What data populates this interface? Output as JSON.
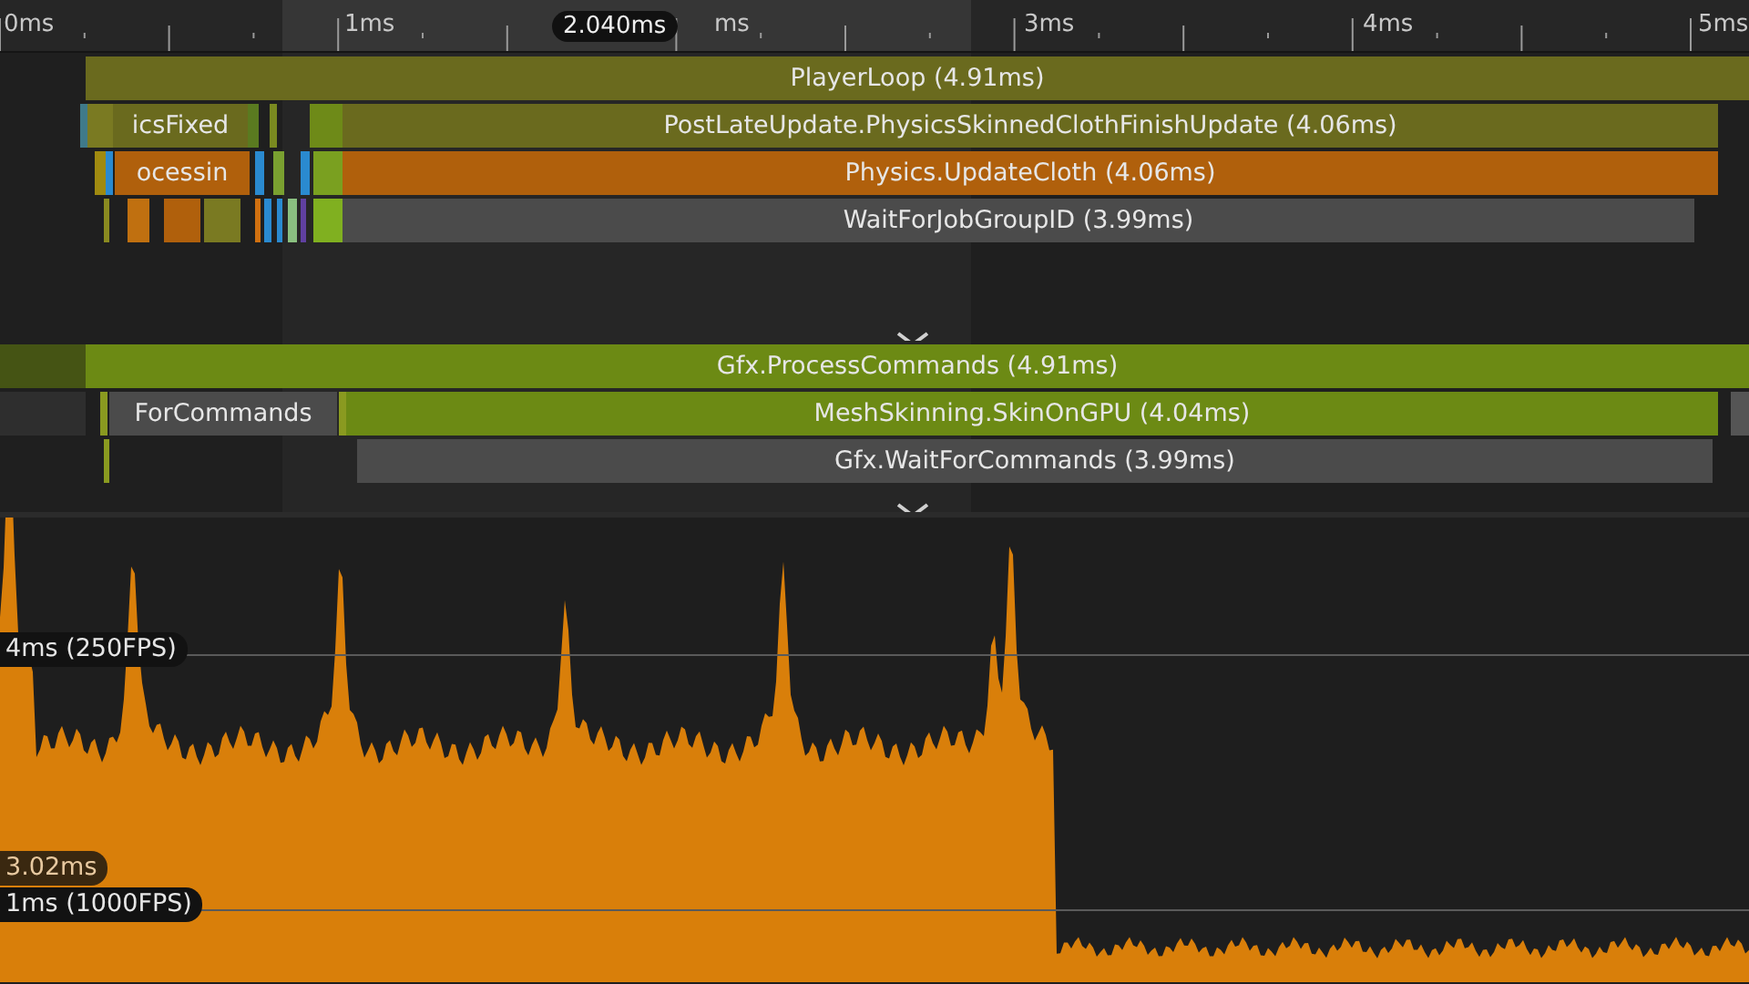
{
  "ruler": {
    "labels": [
      "0ms",
      "1ms",
      "ms",
      "3ms",
      "4ms",
      "5ms"
    ],
    "cursor": "2.040ms"
  },
  "threads": [
    {
      "rows": [
        {
          "bars": [
            {
              "label": "PlayerLoop (4.91ms)",
              "kind": "script"
            }
          ]
        },
        {
          "bars": [
            {
              "label": "icsFixed",
              "kind": "script"
            },
            {
              "label": "PostLateUpdate.PhysicsSkinnedClothFinishUpdate (4.06ms)",
              "kind": "script"
            }
          ]
        },
        {
          "bars": [
            {
              "label": "ocessin",
              "kind": "physics"
            },
            {
              "label": "Physics.UpdateCloth (4.06ms)",
              "kind": "physics"
            }
          ]
        },
        {
          "bars": [
            {
              "label": "WaitForJobGroupID (3.99ms)",
              "kind": "wait"
            }
          ]
        }
      ]
    },
    {
      "rows": [
        {
          "bars": [
            {
              "label": "Gfx.ProcessCommands (4.91ms)",
              "kind": "render"
            }
          ]
        },
        {
          "bars": [
            {
              "label": "ForCommands",
              "kind": "wait"
            },
            {
              "label": "MeshSkinning.SkinOnGPU (4.04ms)",
              "kind": "render"
            }
          ]
        },
        {
          "bars": [
            {
              "label": "Gfx.WaitForCommands (3.99ms)",
              "kind": "wait"
            }
          ]
        }
      ]
    }
  ],
  "graph": {
    "references": [
      {
        "label": "4ms (250FPS)"
      },
      {
        "label": "1ms (1000FPS)"
      }
    ],
    "selected_value": "3.02ms"
  }
}
